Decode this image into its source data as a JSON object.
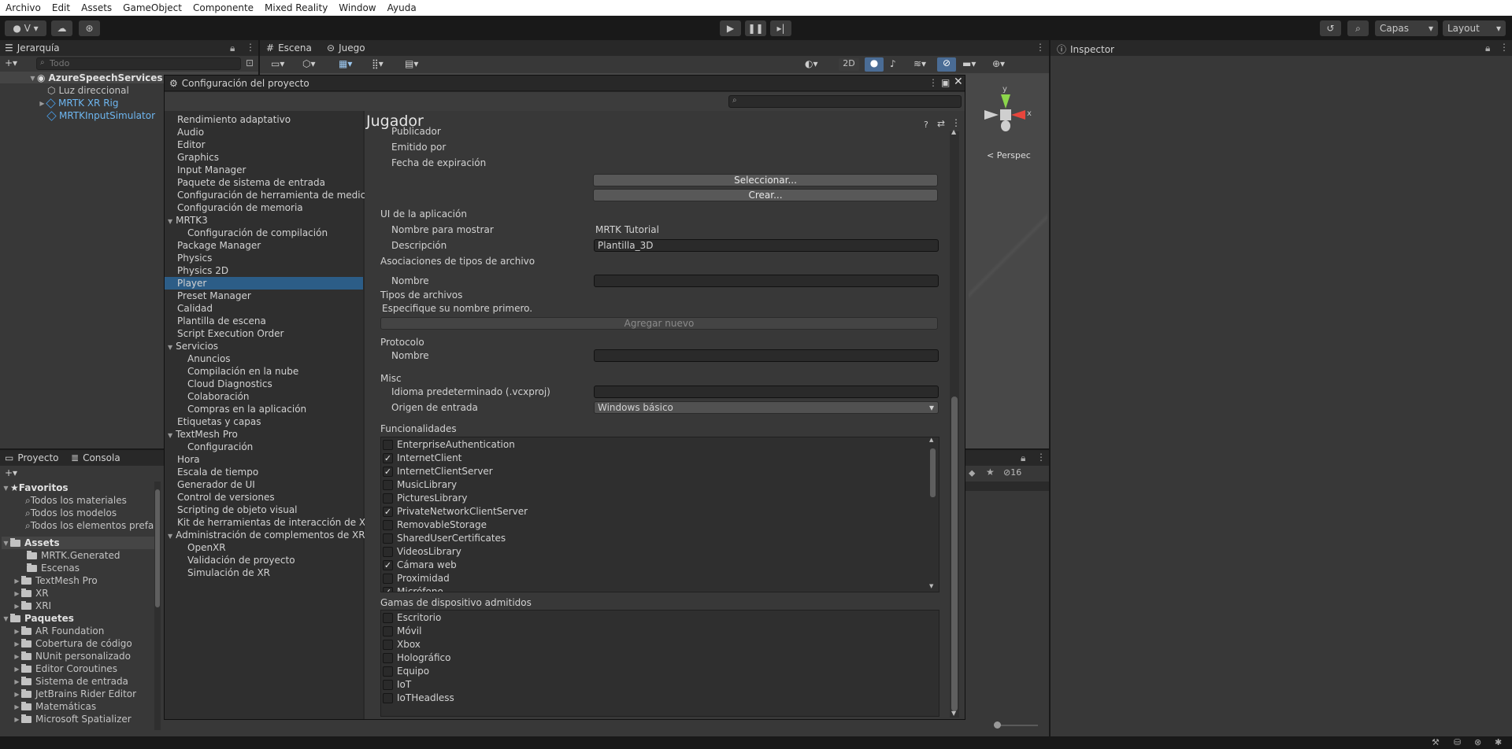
{
  "menubar": [
    "Archivo",
    "Edit",
    "Assets",
    "GameObject",
    "Componente",
    "Mixed Reality",
    "Window",
    "Ayuda"
  ],
  "toolbar": {
    "account_label": "V",
    "layers": "Capas",
    "layout": "Layout"
  },
  "hierarchy": {
    "tab": "Jerarquía",
    "search_placeholder": "Todo",
    "items": [
      {
        "label": "AzureSpeechServices"
      },
      {
        "label": "Luz direccional"
      },
      {
        "label": "MRTK XR Rig"
      },
      {
        "label": "MRTKInputSimulator"
      }
    ]
  },
  "scene_tabs": {
    "scene": "Escena",
    "game": "Juego",
    "mode_2d": "2D",
    "gizmo_y": "y",
    "gizmo_x": "x",
    "persp": "Perspec"
  },
  "inspector_tab": "Inspector",
  "project_panel": {
    "tabs": [
      "Proyecto",
      "Consola"
    ],
    "favorites_label": "Favoritos",
    "favorites": [
      "Todos los materiales",
      "Todos los modelos",
      "Todos los elementos prefab"
    ],
    "assets_label": "Assets",
    "assets": [
      "MRTK.Generated",
      "Escenas",
      "TextMesh Pro",
      "XR",
      "XRI"
    ],
    "packages_label": "Paquetes",
    "packages": [
      "AR Foundation",
      "Cobertura de código",
      "NUnit personalizado",
      "Editor Coroutines",
      "Sistema de entrada",
      "JetBrains Rider Editor",
      "Matemáticas",
      "Microsoft Spatializer"
    ],
    "hidden_count": "16"
  },
  "project_settings": {
    "title": "Configuración del proyecto",
    "nav": [
      {
        "label": "Rendimiento adaptativo",
        "indent": 0
      },
      {
        "label": "Audio",
        "indent": 0
      },
      {
        "label": "Editor",
        "indent": 0
      },
      {
        "label": "Graphics",
        "indent": 0
      },
      {
        "label": "Input Manager",
        "indent": 0
      },
      {
        "label": "Paquete de sistema de entrada",
        "indent": 0
      },
      {
        "label": "Configuración de herramienta de medición",
        "indent": 0
      },
      {
        "label": "Configuración de memoria",
        "indent": 0
      },
      {
        "label": "MRTK3",
        "indent": 0,
        "fold": true
      },
      {
        "label": "Configuración de compilación",
        "indent": 1
      },
      {
        "label": "Package Manager",
        "indent": 0
      },
      {
        "label": "Physics",
        "indent": 0
      },
      {
        "label": "Physics 2D",
        "indent": 0
      },
      {
        "label": "Player",
        "indent": 0,
        "selected": true
      },
      {
        "label": "Preset Manager",
        "indent": 0
      },
      {
        "label": "Calidad",
        "indent": 0
      },
      {
        "label": "Plantilla de escena",
        "indent": 0
      },
      {
        "label": "Script Execution Order",
        "indent": 0
      },
      {
        "label": "Servicios",
        "indent": 0,
        "fold": true
      },
      {
        "label": "Anuncios",
        "indent": 1
      },
      {
        "label": "Compilación en la nube",
        "indent": 1
      },
      {
        "label": "Cloud Diagnostics",
        "indent": 1
      },
      {
        "label": "Colaboración",
        "indent": 1
      },
      {
        "label": "Compras en la aplicación",
        "indent": 1
      },
      {
        "label": "Etiquetas y capas",
        "indent": 0
      },
      {
        "label": "TextMesh Pro",
        "indent": 0,
        "fold": true
      },
      {
        "label": "Configuración",
        "indent": 1
      },
      {
        "label": "Hora",
        "indent": 0
      },
      {
        "label": "Escala de tiempo",
        "indent": 0
      },
      {
        "label": "Generador de UI",
        "indent": 0
      },
      {
        "label": "Control de versiones",
        "indent": 0
      },
      {
        "label": "Scripting de objeto visual",
        "indent": 0
      },
      {
        "label": "Kit de herramientas de interacción de XR",
        "indent": 0
      },
      {
        "label": "Administración de complementos de XR",
        "indent": 0,
        "fold": true
      },
      {
        "label": "OpenXR",
        "indent": 1
      },
      {
        "label": "Validación de proyecto",
        "indent": 1
      },
      {
        "label": "Simulación de XR",
        "indent": 1
      }
    ],
    "page_title": "Jugador",
    "cert": {
      "publisher": "Publicador",
      "issued_by": "Emitido por",
      "expiry": "Fecha de expiración",
      "select_btn": "Seleccionar...",
      "create_btn": "Crear..."
    },
    "app_ui": {
      "header": "UI de la aplicación",
      "display_name_label": "Nombre para mostrar",
      "display_name": "MRTK Tutorial",
      "description_label": "Descripción",
      "description": "Plantilla_3D"
    },
    "file_assoc": {
      "header": "Asociaciones de tipos de archivo",
      "name_label": "Nombre",
      "name": ""
    },
    "file_types": {
      "header": "Tipos de archivos",
      "hint": "Especifique su nombre primero.",
      "add_btn": "Agregar nuevo"
    },
    "protocol": {
      "header": "Protocolo",
      "name_label": "Nombre",
      "name": ""
    },
    "misc": {
      "header": "Misc",
      "lang_label": "Idioma predeterminado (.vcxproj)",
      "lang": "",
      "input_label": "Origen de entrada",
      "input": "Windows básico"
    },
    "capabilities": {
      "header": "Funcionalidades",
      "items": [
        {
          "label": "EnterpriseAuthentication",
          "checked": false
        },
        {
          "label": "InternetClient",
          "checked": true
        },
        {
          "label": "InternetClientServer",
          "checked": true
        },
        {
          "label": "MusicLibrary",
          "checked": false
        },
        {
          "label": "PicturesLibrary",
          "checked": false
        },
        {
          "label": "PrivateNetworkClientServer",
          "checked": true
        },
        {
          "label": "RemovableStorage",
          "checked": false
        },
        {
          "label": "SharedUserCertificates",
          "checked": false
        },
        {
          "label": "VideosLibrary",
          "checked": false
        },
        {
          "label": "Cámara web",
          "checked": true
        },
        {
          "label": "Proximidad",
          "checked": false
        },
        {
          "label": "Micrófono",
          "checked": true
        }
      ]
    },
    "devices": {
      "header": "Gamas de dispositivo admitidos",
      "items": [
        {
          "label": "Escritorio",
          "checked": false
        },
        {
          "label": "Móvil",
          "checked": false
        },
        {
          "label": "Xbox",
          "checked": false
        },
        {
          "label": "Holográfico",
          "checked": false
        },
        {
          "label": "Equipo",
          "checked": false
        },
        {
          "label": "IoT",
          "checked": false
        },
        {
          "label": "IoTHeadless",
          "checked": false
        }
      ]
    }
  },
  "colors": {
    "selected": "#2c5d87",
    "panel": "#383838",
    "window": "#282828"
  }
}
